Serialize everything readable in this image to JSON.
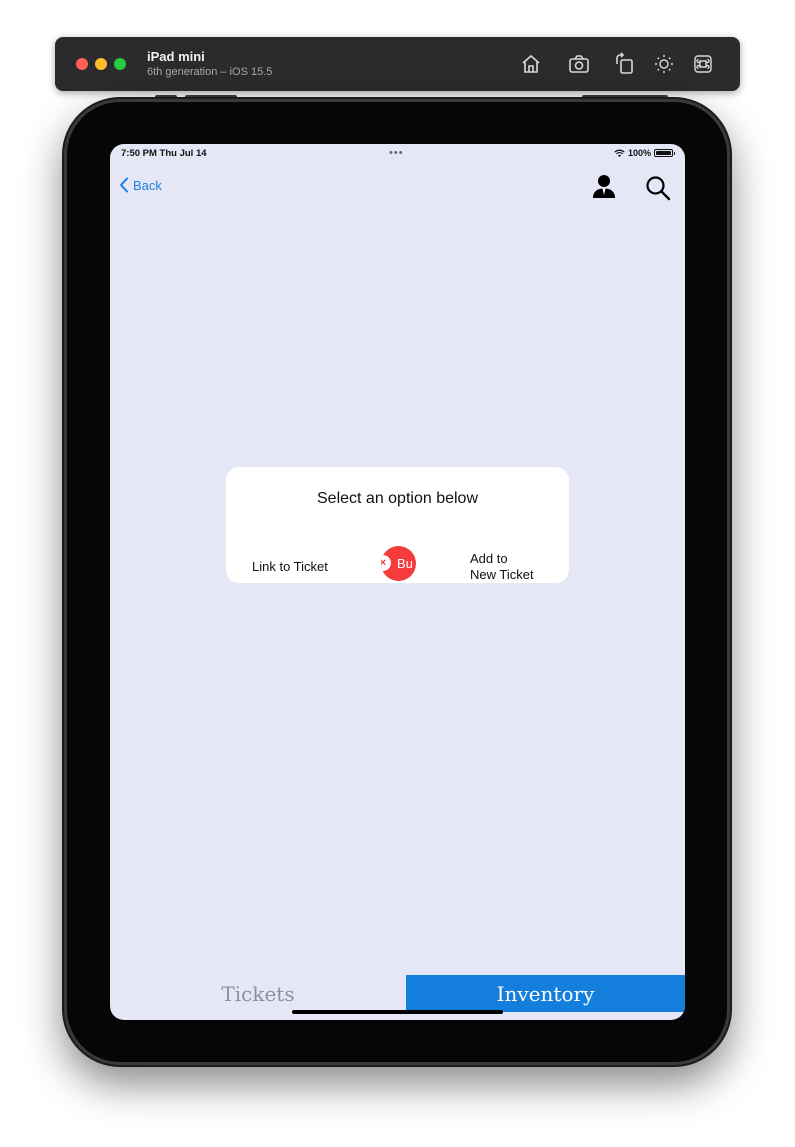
{
  "simulator": {
    "device_name": "iPad mini",
    "device_sub": "6th generation – iOS 15.5",
    "tools": [
      "home-icon",
      "screenshot-icon",
      "rotate-icon",
      "appearance-icon",
      "keyboard-icon"
    ]
  },
  "status_bar": {
    "time_date": "7:50 PM  Thu Jul 14",
    "dots": "•••",
    "battery_pct": "100%"
  },
  "nav": {
    "back_label": "Back",
    "accent_color": "#1a7fe0"
  },
  "dialog": {
    "title": "Select an option below",
    "link_option": "Link to Ticket",
    "button_text": "Bu",
    "button_color": "#f53b3b",
    "add_option_line1": "Add to",
    "add_option_line2": "New Ticket"
  },
  "tabs": {
    "tickets": "Tickets",
    "inventory": "Inventory",
    "active": "Inventory",
    "active_color": "#147edc"
  },
  "colors": {
    "screen_bg": "#e6e7f6"
  }
}
